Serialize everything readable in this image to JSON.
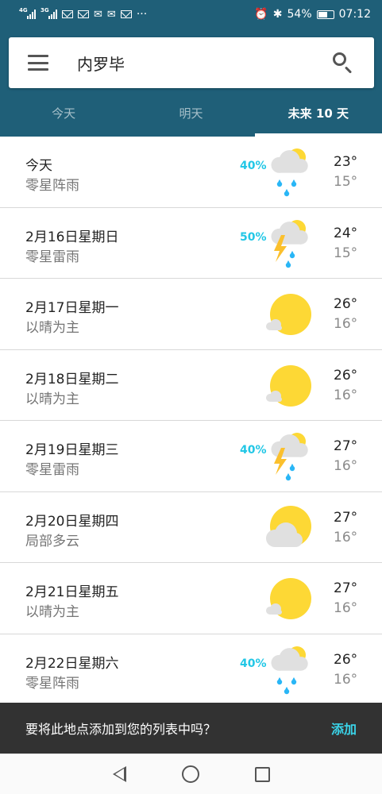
{
  "status_bar": {
    "signal1_tag": "4G",
    "signal2_tag": "3G",
    "extra": "···",
    "battery": "54%",
    "time": "07:12"
  },
  "search": {
    "location": "内罗毕"
  },
  "tabs": [
    {
      "label": "今天",
      "active": false
    },
    {
      "label": "明天",
      "active": false
    },
    {
      "label": "未来 10 天",
      "active": true
    }
  ],
  "forecast": [
    {
      "date": "今天",
      "condition": "零星阵雨",
      "precip": "40%",
      "icon": "rain-partly-sunny-icon",
      "high": "23°",
      "low": "15°"
    },
    {
      "date": "2月16日星期日",
      "condition": "零星雷雨",
      "precip": "50%",
      "icon": "thunderstorm-icon",
      "high": "24°",
      "low": "15°"
    },
    {
      "date": "2月17日星期一",
      "condition": "以晴为主",
      "precip": "",
      "icon": "mostly-sunny-icon",
      "high": "26°",
      "low": "16°"
    },
    {
      "date": "2月18日星期二",
      "condition": "以晴为主",
      "precip": "",
      "icon": "mostly-sunny-icon",
      "high": "26°",
      "low": "16°"
    },
    {
      "date": "2月19日星期三",
      "condition": "零星雷雨",
      "precip": "40%",
      "icon": "thunderstorm-icon",
      "high": "27°",
      "low": "16°"
    },
    {
      "date": "2月20日星期四",
      "condition": "局部多云",
      "precip": "",
      "icon": "partly-cloudy-icon",
      "high": "27°",
      "low": "16°"
    },
    {
      "date": "2月21日星期五",
      "condition": "以晴为主",
      "precip": "",
      "icon": "mostly-sunny-icon",
      "high": "27°",
      "low": "16°"
    },
    {
      "date": "2月22日星期六",
      "condition": "零星阵雨",
      "precip": "40%",
      "icon": "rain-partly-sunny-icon",
      "high": "26°",
      "low": "16°"
    }
  ],
  "snackbar": {
    "message": "要将此地点添加到您的列表中吗？",
    "action": "添加"
  },
  "colors": {
    "header": "#1f5f78",
    "accent": "#22c7e6",
    "sun": "#fdd835",
    "cloud": "#e0e0e0",
    "rain": "#29b6f6",
    "bolt": "#fbc02d"
  }
}
